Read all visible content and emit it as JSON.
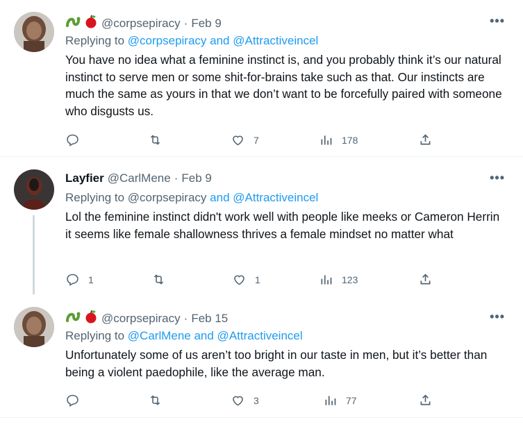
{
  "tweets": [
    {
      "handle": "@corpsepiracy",
      "date": "Feb 9",
      "replying_prefix": "Replying to",
      "replying_to": "@corpsepiracy and @Attractiveincel",
      "body": "You have no idea what a feminine instinct is, and you probably think it’s our natural instinct to serve men or some shit-for-brains take such as that. Our instincts are much the same as yours in that we don’t want to be forcefully paired with someone who disgusts us.",
      "replies": "",
      "retweets": "",
      "likes": "7",
      "views": "178"
    },
    {
      "name": "Layfier",
      "handle": "@CarlMene",
      "date": "Feb 9",
      "replying_prefix": "Replying to",
      "replying_user": "@corpsepiracy",
      "replying_rest": "and @Attractiveincel",
      "body": "Lol the feminine instinct didn't work well with people like meeks or Cameron Herrin it seems like female shallowness thrives a female mindset no matter what",
      "replies": "1",
      "retweets": "",
      "likes": "1",
      "views": "123"
    },
    {
      "handle": "@corpsepiracy",
      "date": "Feb 15",
      "replying_prefix": "Replying to",
      "replying_to": "@CarlMene and @Attractiveincel",
      "body": "Unfortunately some of us aren’t too bright in our taste in men, but it’s better than being a violent paedophile, like the average man.",
      "replies": "",
      "retweets": "",
      "likes": "3",
      "views": "77"
    }
  ],
  "header_separator": "·",
  "more_label": "•••",
  "icons": [
    "emoji-snake-icon",
    "emoji-apple-icon",
    "reply-icon",
    "retweet-icon",
    "like-icon",
    "views-icon",
    "share-icon",
    "more-icon"
  ],
  "colors": {
    "link": "#1d9bf0",
    "muted": "#536471",
    "text": "#0f1419",
    "divider": "#eff3f4"
  }
}
